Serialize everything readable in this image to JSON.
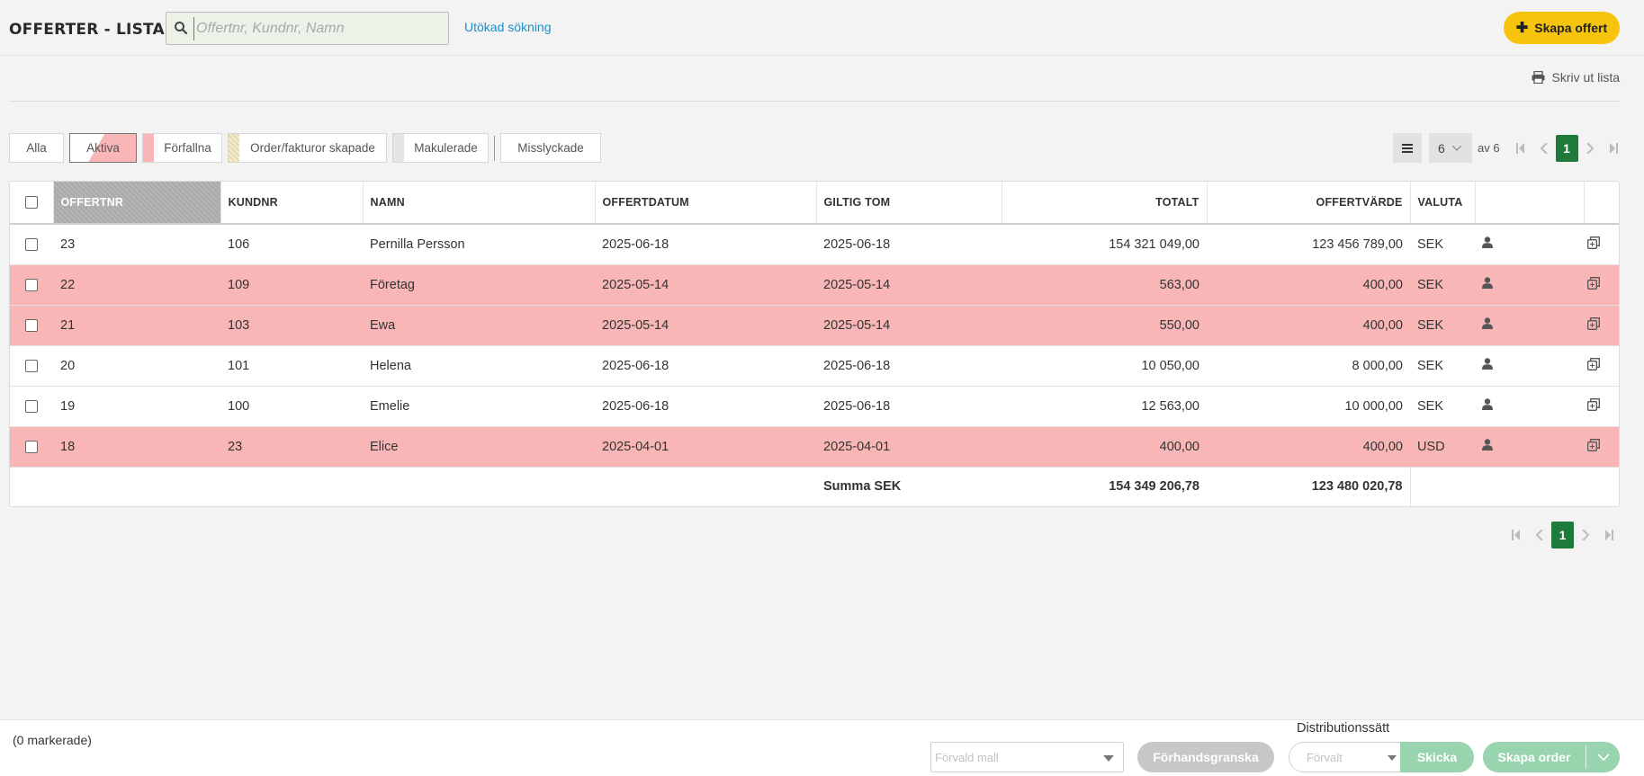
{
  "header": {
    "title": "OFFERTER - LISTA",
    "search_placeholder": "Offertnr, Kundnr, Namn",
    "extended_search": "Utökad sökning",
    "create_button": "Skapa offert"
  },
  "print_label": "Skriv ut lista",
  "filters": {
    "all": "Alla",
    "active": "Aktiva",
    "overdue": "Förfallna",
    "orders_created": "Order/fakturor skapade",
    "void": "Makulerade",
    "failed": "Misslyckade"
  },
  "pager": {
    "page_size": "6",
    "of_label": "av 6",
    "current_page": "1"
  },
  "table": {
    "columns": {
      "quote_no": "OFFERTNR",
      "customer_no": "KUNDNR",
      "name": "NAMN",
      "quote_date": "OFFERTDATUM",
      "valid_until": "GILTIG TOM",
      "total": "TOTALT",
      "quote_value": "OFFERTVÄRDE",
      "currency": "VALUTA"
    },
    "rows": [
      {
        "quote_no": "23",
        "customer_no": "106",
        "name": "Pernilla Persson",
        "quote_date": "2025-06-18",
        "valid_until": "2025-06-18",
        "total": "154 321 049,00",
        "quote_value": "123 456 789,00",
        "currency": "SEK",
        "overdue": false
      },
      {
        "quote_no": "22",
        "customer_no": "109",
        "name": "Företag",
        "quote_date": "2025-05-14",
        "valid_until": "2025-05-14",
        "total": "563,00",
        "quote_value": "400,00",
        "currency": "SEK",
        "overdue": true
      },
      {
        "quote_no": "21",
        "customer_no": "103",
        "name": "Ewa",
        "quote_date": "2025-05-14",
        "valid_until": "2025-05-14",
        "total": "550,00",
        "quote_value": "400,00",
        "currency": "SEK",
        "overdue": true
      },
      {
        "quote_no": "20",
        "customer_no": "101",
        "name": "Helena",
        "quote_date": "2025-06-18",
        "valid_until": "2025-06-18",
        "total": "10 050,00",
        "quote_value": "8 000,00",
        "currency": "SEK",
        "overdue": false
      },
      {
        "quote_no": "19",
        "customer_no": "100",
        "name": "Emelie",
        "quote_date": "2025-06-18",
        "valid_until": "2025-06-18",
        "total": "12 563,00",
        "quote_value": "10 000,00",
        "currency": "SEK",
        "overdue": false
      },
      {
        "quote_no": "18",
        "customer_no": "23",
        "name": "Elice",
        "quote_date": "2025-04-01",
        "valid_until": "2025-04-01",
        "total": "400,00",
        "quote_value": "400,00",
        "currency": "USD",
        "overdue": true
      }
    ],
    "summary": {
      "label": "Summa SEK",
      "total": "154 349 206,78",
      "quote_value": "123 480 020,78"
    }
  },
  "bottom": {
    "marked": "(0 markerade)",
    "template_placeholder": "Förvald mall",
    "preview_button": "Förhandsgranska",
    "distribution_label": "Distributionssätt",
    "distribution_value": "Förvalt",
    "send_button": "Skicka",
    "create_order_button": "Skapa order"
  },
  "colors": {
    "accent_yellow": "#f6c40f",
    "overdue_row": "#f8b6b6",
    "active_page": "#1e7a3a",
    "link_blue": "#1b8fc6",
    "disabled_green": "#98d4ad"
  },
  "icons": {
    "search": "search-icon",
    "plus": "plus-icon",
    "printer": "printer-icon",
    "list": "list-icon",
    "user": "user-icon",
    "copy": "copy-icon"
  }
}
